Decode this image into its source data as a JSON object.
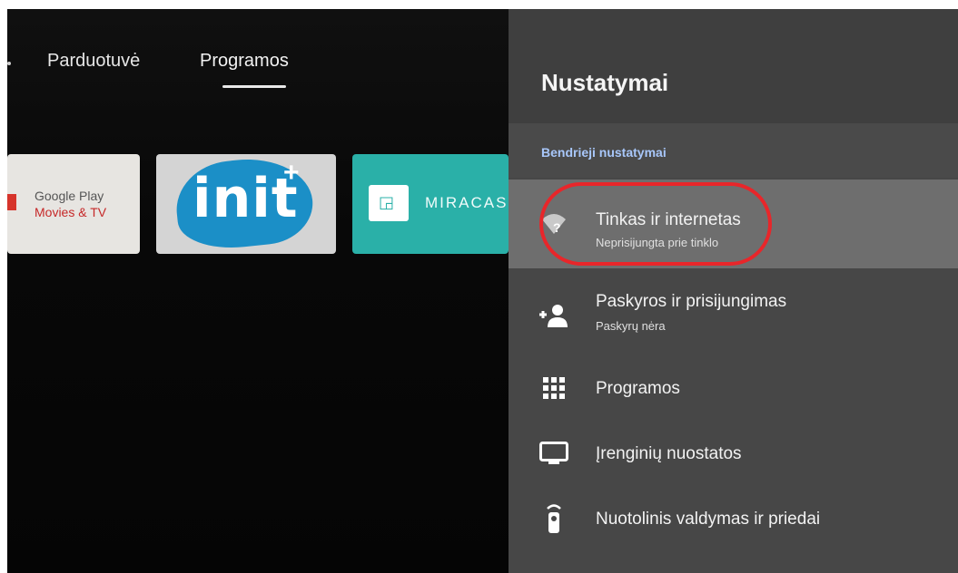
{
  "nav": {
    "tabs": [
      {
        "label": "Parduotuvė"
      },
      {
        "label": "Programos"
      }
    ]
  },
  "apps": {
    "google_play": {
      "line1": "Google Play",
      "line2": "Movies & TV"
    },
    "init": {
      "text": "init",
      "superscript": "+"
    },
    "miracast": {
      "text": "MIRACAS"
    }
  },
  "settings": {
    "title": "Nustatymai",
    "section": "Bendrieji nustatymai",
    "items": [
      {
        "title": "Tinkas ir internetas",
        "subtitle": "Neprisijungta prie tinklo",
        "icon": "wifi-question-icon"
      },
      {
        "title": "Paskyros ir prisijungimas",
        "subtitle": "Paskyrų nėra",
        "icon": "add-person-icon"
      },
      {
        "title": "Programos",
        "icon": "apps-grid-icon"
      },
      {
        "title": "Įrenginių nuostatos",
        "icon": "tv-icon"
      },
      {
        "title": "Nuotolinis valdymas ir priedai",
        "icon": "remote-icon"
      }
    ]
  },
  "colors": {
    "highlight_ring": "#e8262a",
    "section_label": "#a8c7fa",
    "panel": "#474747",
    "miracast_tile": "#2ab0a8"
  }
}
